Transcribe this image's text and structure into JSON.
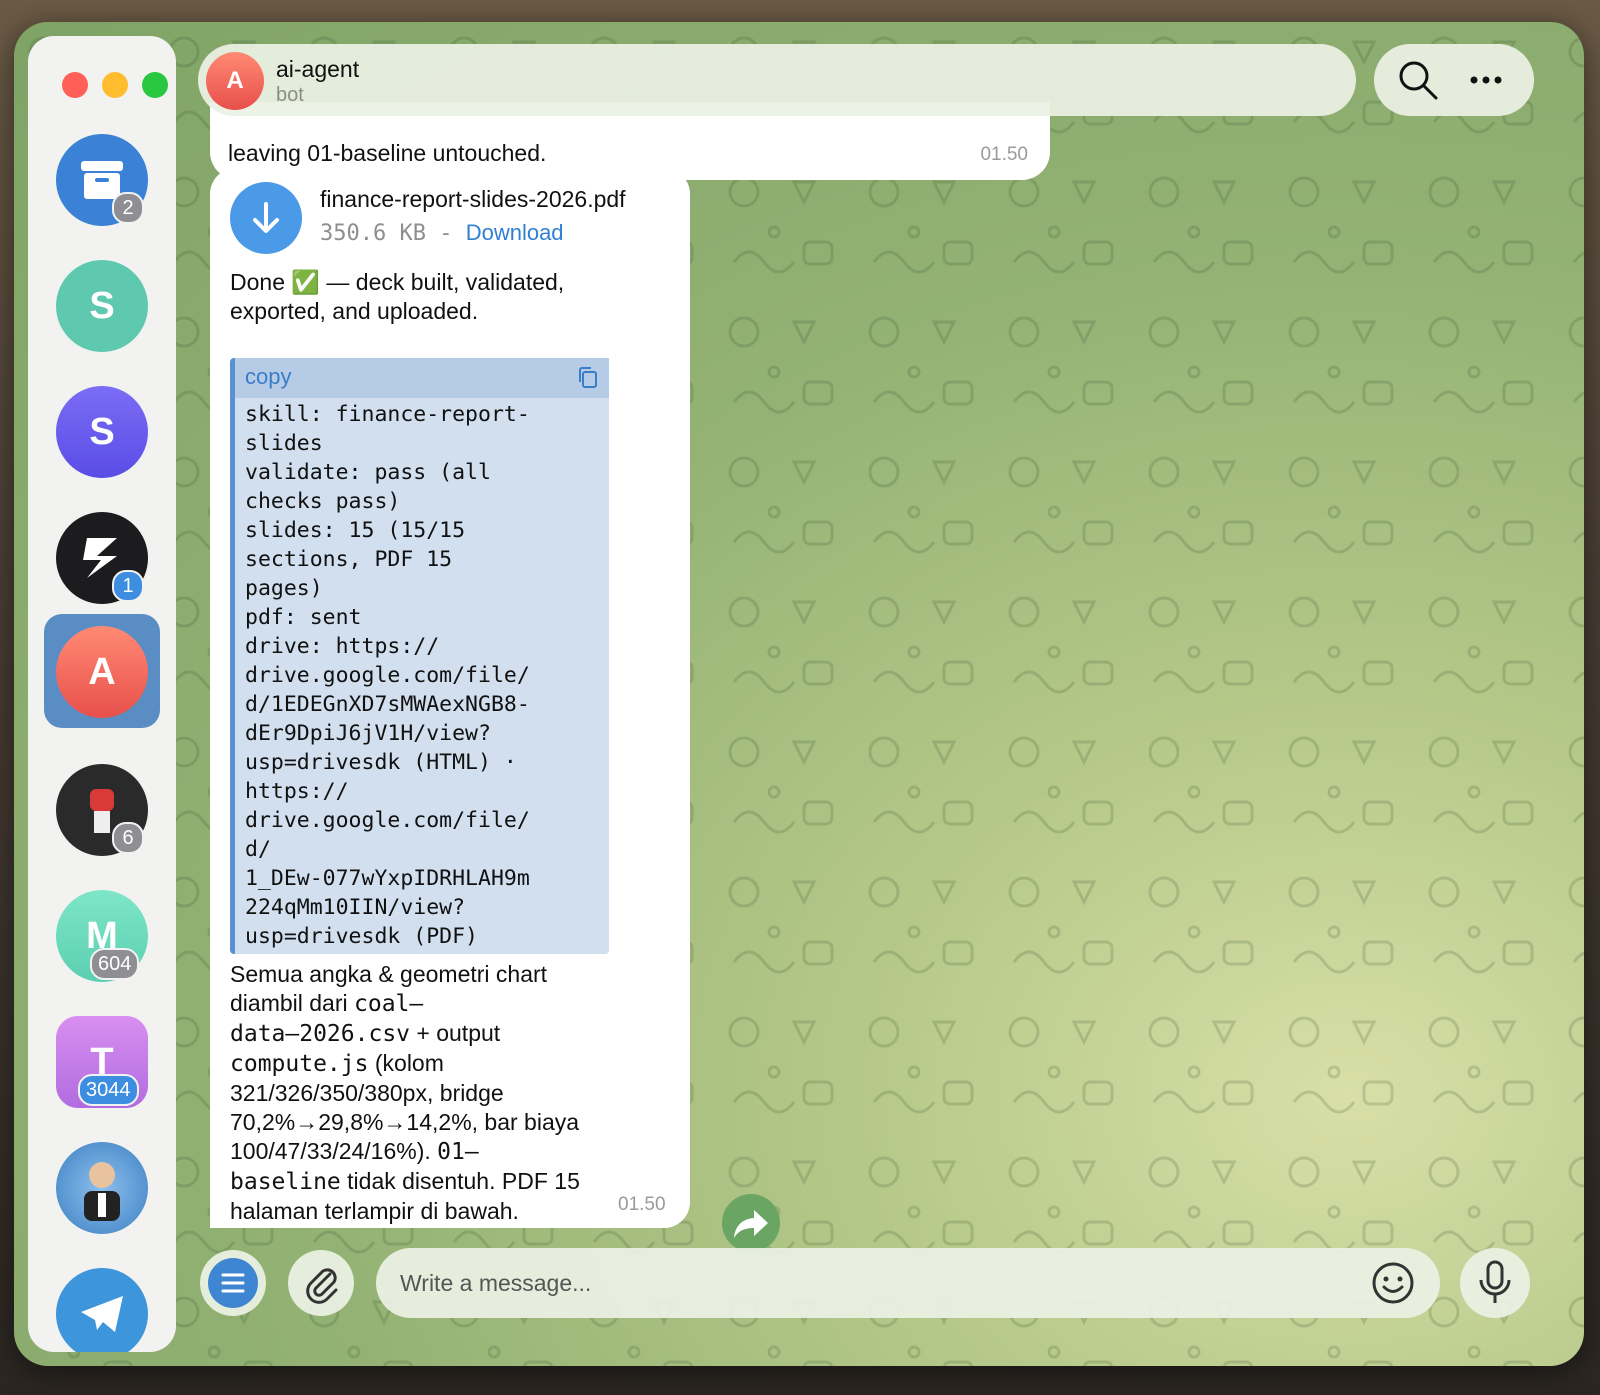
{
  "window": {
    "traffic_lights": [
      "close",
      "minimize",
      "zoom"
    ]
  },
  "sidebar": {
    "items": [
      {
        "name": "archive",
        "letter": "",
        "color": "#3b82d6",
        "badge": "2"
      },
      {
        "name": "chat-s-teal",
        "letter": "S",
        "color": "#5fc9b0",
        "badge": ""
      },
      {
        "name": "chat-s-purple",
        "letter": "S",
        "color": "#6a5cf0",
        "badge": ""
      },
      {
        "name": "chat-s-dark",
        "letter": "",
        "color": "#1c1c1e",
        "badge": "1"
      },
      {
        "name": "chat-a-active",
        "letter": "A",
        "color": "#e8504b",
        "badge": ""
      },
      {
        "name": "chat-fist",
        "letter": "",
        "color": "#2a2a2a",
        "badge": "6"
      },
      {
        "name": "chat-m",
        "letter": "M",
        "color": "#6fdcc0",
        "badge": "604"
      },
      {
        "name": "chat-t",
        "letter": "T",
        "color": "#c67ee8",
        "badge": "3044"
      },
      {
        "name": "chat-person",
        "letter": "",
        "color": "#4b86c9",
        "badge": ""
      },
      {
        "name": "telegram",
        "letter": "",
        "color": "#3d95dc",
        "badge": ""
      }
    ]
  },
  "header": {
    "avatar_letter": "A",
    "title": "ai-agent",
    "subtitle": "bot",
    "icons": [
      "search-icon",
      "more-icon"
    ]
  },
  "messages": {
    "previous": {
      "text": "leaving 01-baseline untouched.",
      "time": "01.50"
    },
    "current": {
      "file_name": "finance-report-slides-2026.pdf",
      "file_size": "350.6 KB - ",
      "download_label": "Download",
      "intro": "Done ✅ — deck built, validated,\nexported, and uploaded.",
      "code_header": "copy",
      "code_lines": "skill: finance-report-\nslides\nvalidate: pass (all\nchecks pass)\nslides: 15 (15/15\nsections, PDF 15\npages)\npdf: sent\ndrive: https://\ndrive.google.com/file/\nd/1EDEGnXD7sMWAexNGB8-\ndEr9DpiJ6jV1H/view?\nusp=drivesdk (HTML) ·\nhttps://\ndrive.google.com/file/\nd/\n1_DEw-077wYxpIDRHLAH9m\n224qMm10IIN/view?\nusp=drivesdk (PDF)",
      "outro": {
        "l1": "Semua angka & geometri chart",
        "l2a": "diambil dari ",
        "l2b": "coal–",
        "l3a": "data–2026.csv",
        "l3b": " + output",
        "l4a": "compute.js",
        "l4b": " (kolom",
        "l5": "321/326/350/380px, bridge",
        "l6": "70,2%→29,8%→14,2%, bar biaya",
        "l7a": "100/47/33/24/16%). ",
        "l7b": "01–",
        "l8a": "baseline",
        "l8b": " tidak disentuh. PDF 15",
        "l9": "halaman terlampir di bawah."
      },
      "time": "01.50"
    }
  },
  "composer": {
    "placeholder": "Write a message..."
  }
}
